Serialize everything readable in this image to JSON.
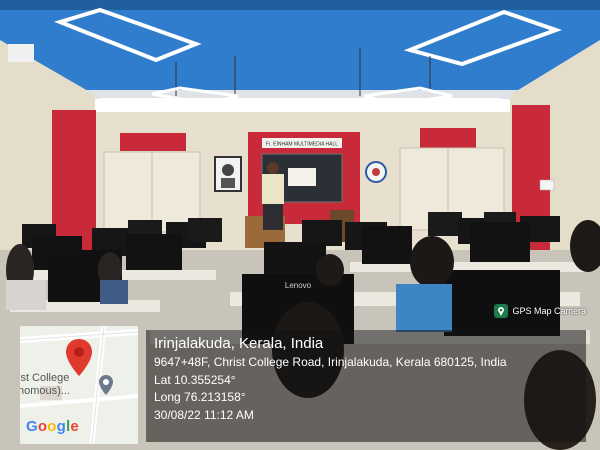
{
  "banner": {
    "hall_name": "Fr. EINHAM MULTIMEDIA HALL"
  },
  "screen_brand": "Lenovo",
  "app_badge": {
    "label": "GPS Map Camera",
    "icon": "gps-camera-icon"
  },
  "map": {
    "place_label_1": "ist College",
    "place_label_2": "homous)...",
    "logo": "Google",
    "pin_icon": "location-pin-icon",
    "logo_colors": [
      "#4285F4",
      "#EA4335",
      "#FBBC05",
      "#4285F4",
      "#34A853",
      "#EA4335"
    ]
  },
  "location": {
    "title": "Irinjalakuda, Kerala, India",
    "address": "9647+48F, Christ College Road, Irinjalakuda, Kerala 680125, India",
    "lat": "Lat 10.355254°",
    "long": "Long 76.213158°",
    "datetime": "30/08/22 11:12 AM"
  },
  "colors": {
    "ceiling_blue": "#2a76c6",
    "wall_red": "#c82a3a",
    "wall_cream": "#e7e0cf"
  }
}
